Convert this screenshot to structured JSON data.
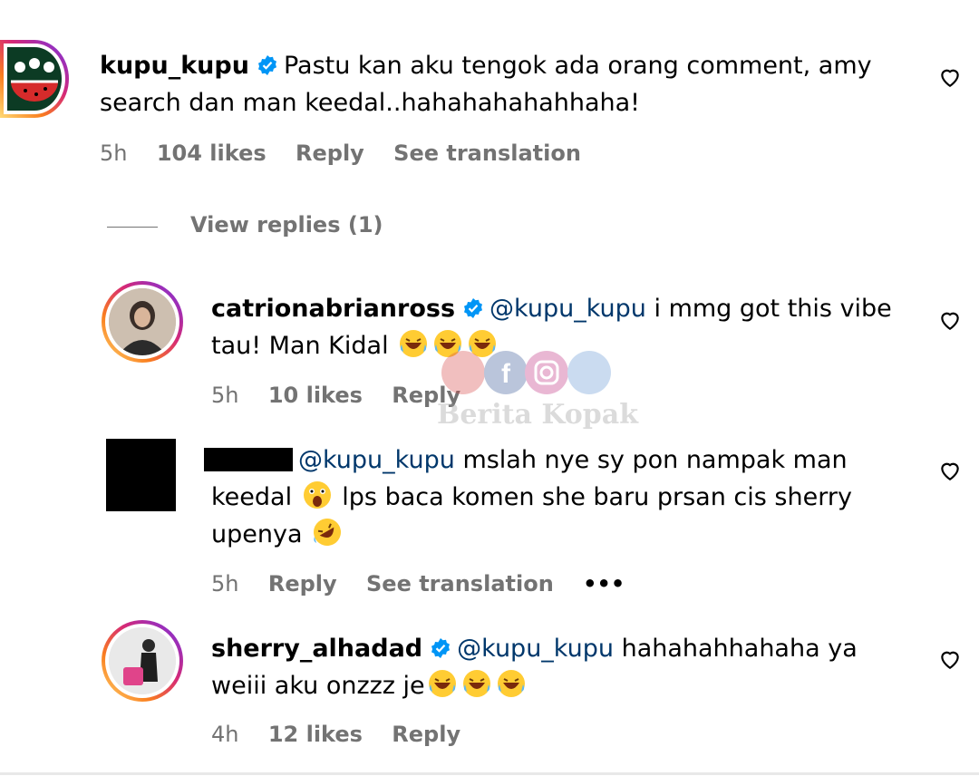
{
  "comments": [
    {
      "username": "kupu_kupu",
      "mention": "",
      "text": "Pastu kan aku tengok ada orang comment, amy search dan man keedal..hahahahahahhaha!",
      "time": "5h",
      "likes": "104 likes",
      "reply": "Reply",
      "translate": "See translation"
    },
    {
      "username": "catrionabrianross",
      "mention": "@kupu_kupu",
      "text_line1": "i mmg got this vibe",
      "text_line2": "tau! Man Kidal",
      "time": "5h",
      "likes": "10 likes",
      "reply": "Reply"
    },
    {
      "username": "",
      "mention": "@kupu_kupu",
      "text_line1": "mslah nye sy pon nampak man",
      "text_line2a": "keedal",
      "text_line2b": "lps baca komen she baru prsan cis sherry",
      "text_line3": "upenya",
      "time": "5h",
      "reply": "Reply",
      "translate": "See translation",
      "more": "•••"
    },
    {
      "username": "sherry_alhadad",
      "mention": "@kupu_kupu",
      "text_line1": "hahahahhahaha ya",
      "text_line2": "weiii aku onzzz je",
      "time": "4h",
      "likes": "12 likes",
      "reply": "Reply"
    }
  ],
  "view_replies": "View replies (1)",
  "watermark": "Berita Kopak",
  "colors": {
    "mention": "#00376b",
    "meta": "#737373",
    "verified": "#0095f6"
  },
  "icons": [
    "heart-icon",
    "verified-badge-icon",
    "laughing-emoji-icon",
    "astonished-emoji-icon",
    "rolling-laughing-emoji-icon",
    "more-icon"
  ]
}
